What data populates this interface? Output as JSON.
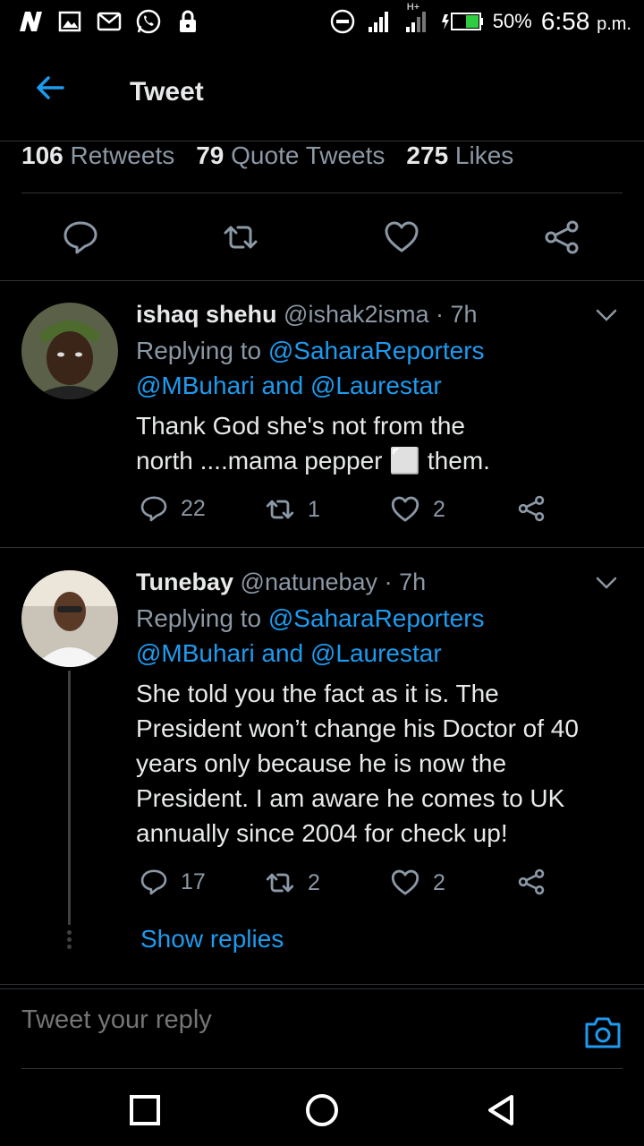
{
  "statusbar": {
    "battery": "50%",
    "time": "6:58",
    "ampm": "p.m.",
    "network": "H+",
    "icons": [
      "n-icon",
      "gallery-icon",
      "gmail-icon",
      "whatsapp-icon",
      "lock-icon",
      "dnd-icon",
      "signal-icon",
      "battery-icon"
    ]
  },
  "header": {
    "title": "Tweet"
  },
  "stats": {
    "retweets_count": "106",
    "retweets_label": "Retweets",
    "quotes_count": "79",
    "quotes_label": "Quote Tweets",
    "likes_count": "275",
    "likes_label": "Likes"
  },
  "tweets": [
    {
      "name": "ishaq shehu",
      "handle": "@ishak2isma",
      "time": "· 7h",
      "replying_prefix": "Replying to ",
      "mention1": "@SaharaReporters",
      "mention2": "@MBuhari",
      "and": " and ",
      "mention3": "@Laurestar",
      "text_line1": "Thank God she's not from the",
      "text_line2": "north ....mama pepper ⬜ them.",
      "replies": "22",
      "retweets": "1",
      "likes": "2"
    },
    {
      "name": "Tunebay",
      "handle": "@natunebay",
      "time": "· 7h",
      "replying_prefix": "Replying to ",
      "mention1": "@SaharaReporters",
      "mention2": "@MBuhari",
      "and": " and ",
      "mention3": "@Laurestar",
      "text_line1": "She told you the fact as it is. The",
      "text_line2": "President won’t change his Doctor of 40",
      "text_line3": "years only because he is now the",
      "text_line4": "President. I am aware he comes to UK",
      "text_line5": "annually since 2004 for check up!",
      "replies": "17",
      "retweets": "2",
      "likes": "2",
      "show_replies": "Show replies"
    }
  ],
  "composer": {
    "placeholder": "Tweet your reply"
  },
  "colors": {
    "background": "#000000",
    "accent": "#1d9bf0",
    "muted": "#8b98a5",
    "text": "#e7e9ea",
    "divider": "#2f3336"
  }
}
